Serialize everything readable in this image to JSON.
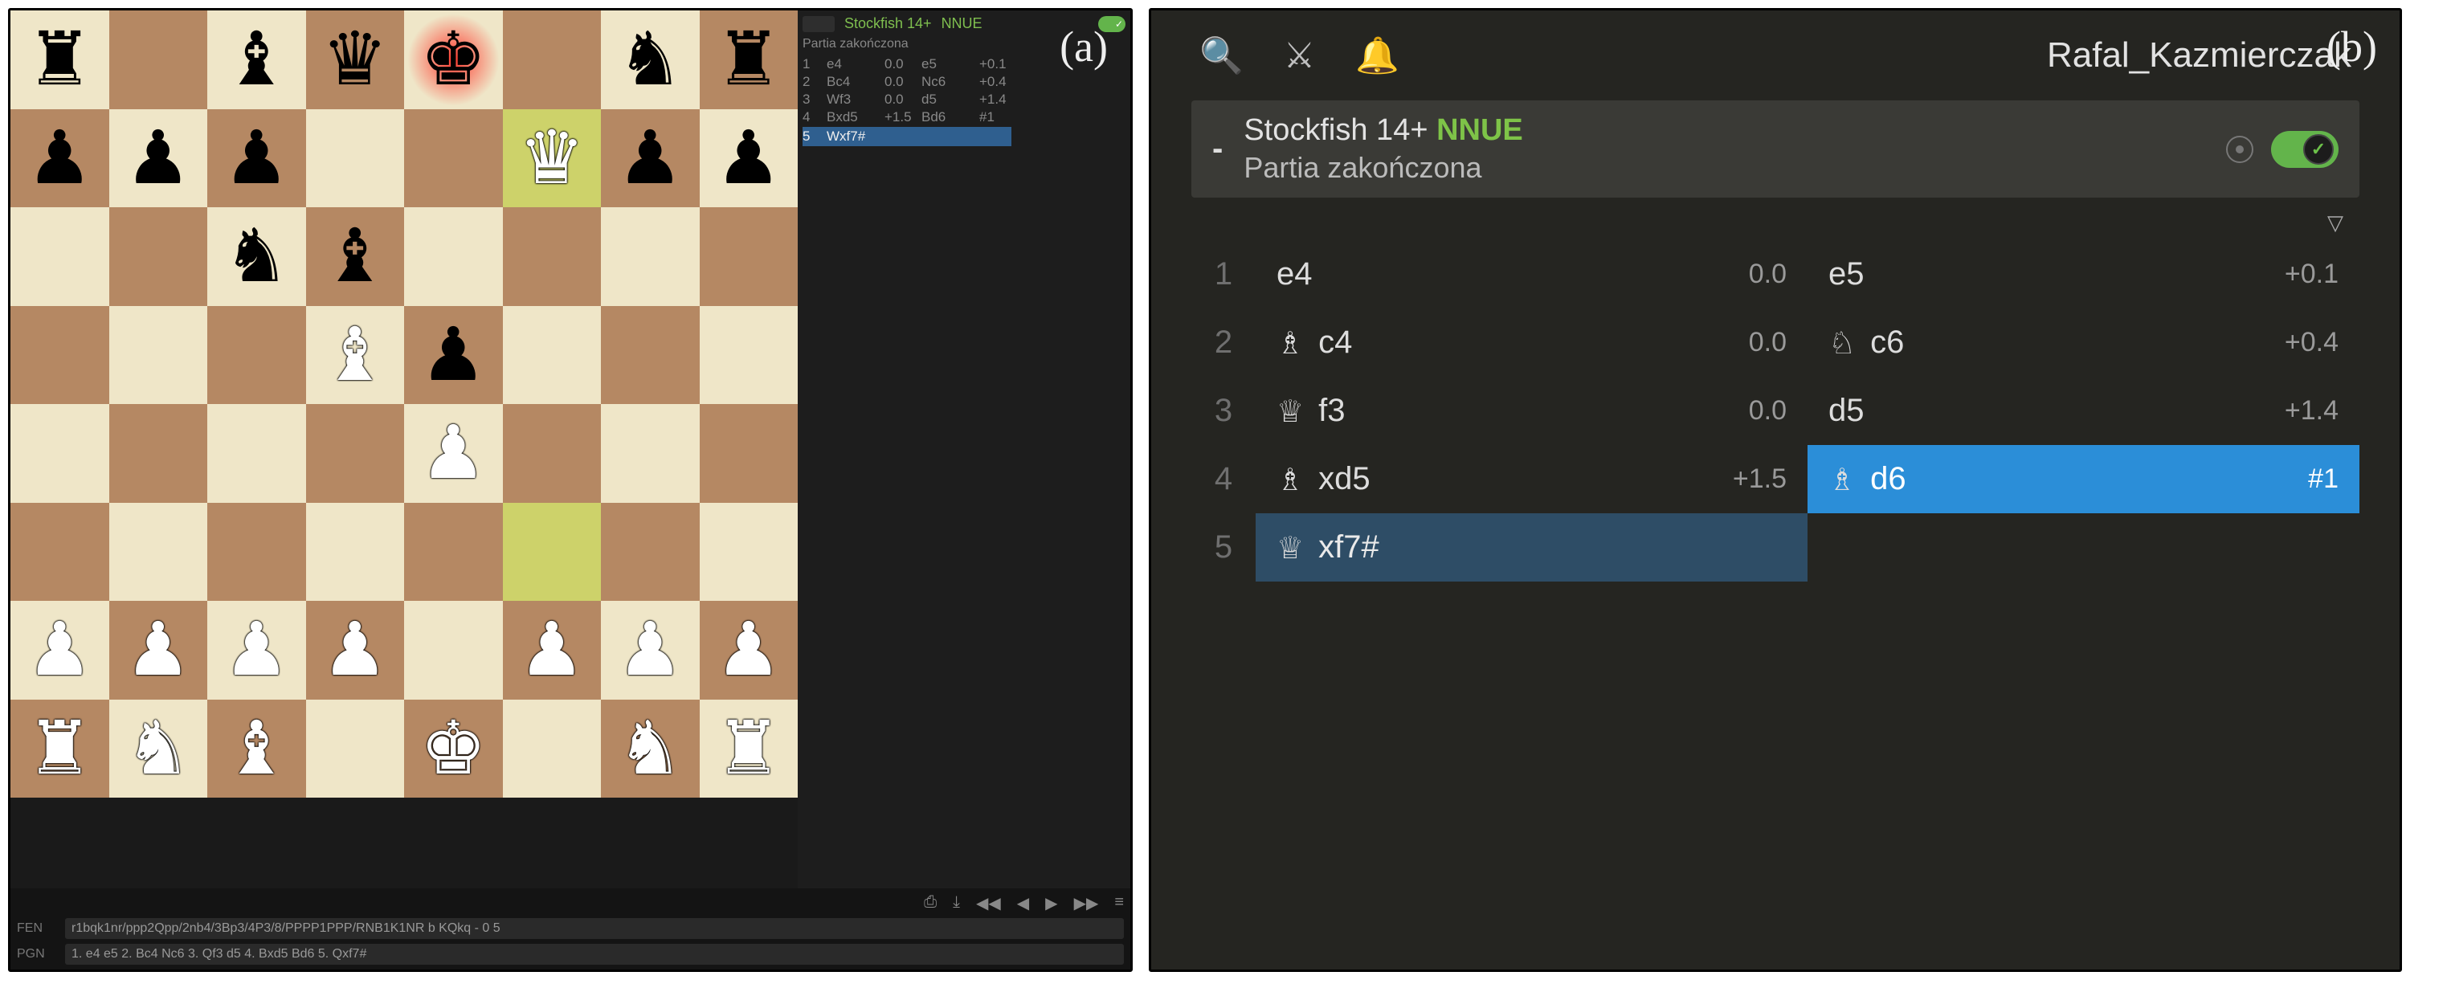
{
  "labels": {
    "a": "(a)",
    "b": "(b)"
  },
  "board": {
    "highlight_from": "f3",
    "highlight_to": "f7",
    "check_square": "e8",
    "pieces": {
      "a8": "br",
      "c8": "bb",
      "d8": "bq",
      "e8": "bk",
      "g8": "bn",
      "h8": "br",
      "a7": "bp",
      "b7": "bp",
      "c7": "bp",
      "f7": "wq",
      "g7": "bp",
      "h7": "bp",
      "c6": "bn",
      "d6": "bb",
      "d5": "wb",
      "e5": "bp",
      "e4": "wp",
      "a2": "wp",
      "b2": "wp",
      "c2": "wp",
      "d2": "wp",
      "f2": "wp",
      "g2": "wp",
      "h2": "wp",
      "a1": "wr",
      "b1": "wn",
      "c1": "wb",
      "e1": "wk",
      "g1": "wn",
      "h1": "wr"
    }
  },
  "mini_panel": {
    "engine": "Stockfish 14+",
    "tag": "NNUE",
    "status": "Partia zakończona",
    "rows": [
      {
        "n": "1",
        "w": "e4",
        "we": "0.0",
        "b": "e5",
        "be": "+0.1"
      },
      {
        "n": "2",
        "w": "Bc4",
        "we": "0.0",
        "b": "Nc6",
        "be": "+0.4"
      },
      {
        "n": "3",
        "w": "Wf3",
        "we": "0.0",
        "b": "d5",
        "be": "+1.4"
      },
      {
        "n": "4",
        "w": "Bxd5",
        "we": "+1.5",
        "b": "Bd6",
        "be": "#1"
      },
      {
        "n": "5",
        "w": "Wxf7#",
        "we": "",
        "b": "",
        "be": ""
      }
    ],
    "selected_row_index": 4
  },
  "bottom": {
    "fen_label": "FEN",
    "fen": "r1bqk1nr/ppp2Qpp/2nb4/3Bp3/4P3/8/PPPP1PPP/RNB1K1NR b KQkq - 0 5",
    "pgn_label": "PGN",
    "pgn": "1. e4 e5 2. Bc4 Nc6 3. Qf3 d5 4. Bxd5 Bd6 5. Qxf7#",
    "controls": [
      "⎙",
      "⤓",
      "◀◀",
      "◀",
      "▶",
      "▶▶",
      "≡"
    ]
  },
  "panel_b": {
    "user": "Rafal_Kazmierczak",
    "engine": "Stockfish 14+",
    "tag": "NNUE",
    "status": "Partia zakończona",
    "moves": [
      {
        "n": "1",
        "w": {
          "sym": "",
          "san": "e4",
          "eval": "0.0"
        },
        "b": {
          "sym": "",
          "san": "e5",
          "eval": "+0.1"
        }
      },
      {
        "n": "2",
        "w": {
          "sym": "♗",
          "san": "c4",
          "eval": "0.0"
        },
        "b": {
          "sym": "♘",
          "san": "c6",
          "eval": "+0.4"
        }
      },
      {
        "n": "3",
        "w": {
          "sym": "♕",
          "san": "f3",
          "eval": "0.0"
        },
        "b": {
          "sym": "",
          "san": "d5",
          "eval": "+1.4"
        }
      },
      {
        "n": "4",
        "w": {
          "sym": "♗",
          "san": "xd5",
          "eval": "+1.5"
        },
        "b": {
          "sym": "♗",
          "san": "d6",
          "eval": "#1",
          "hl": "blue"
        }
      },
      {
        "n": "5",
        "w": {
          "sym": "♕",
          "san": "xf7#",
          "eval": "",
          "hl": "dark"
        },
        "b": null
      }
    ]
  }
}
